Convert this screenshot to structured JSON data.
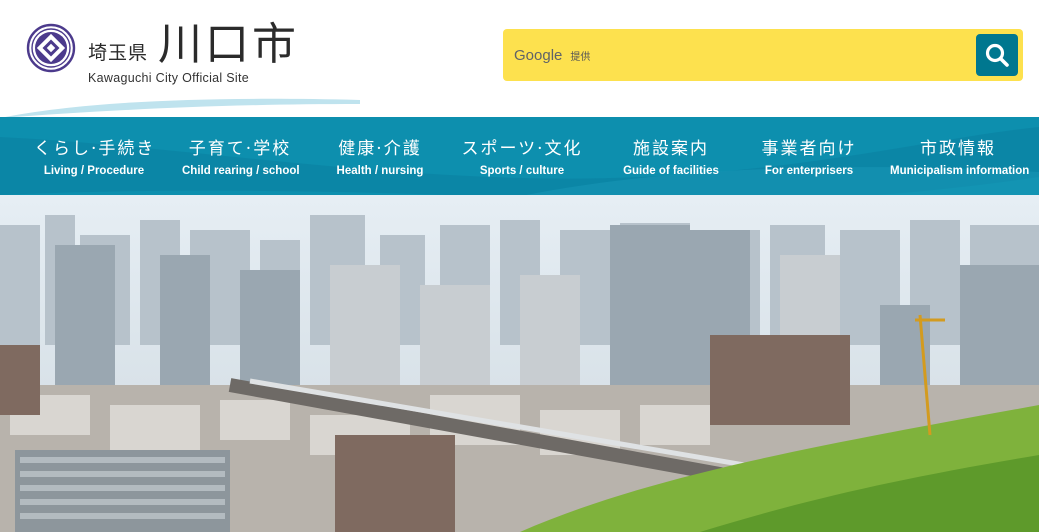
{
  "header": {
    "prefecture": "埼玉県",
    "city": "川口市",
    "subtitle": "Kawaguchi City Official Site"
  },
  "search": {
    "brand": "Google",
    "provided_by": "提供",
    "placeholder": "",
    "accent_color": "#fde14e",
    "button_color": "#00778f"
  },
  "nav": {
    "background_color": "#0d8fae",
    "items": [
      {
        "jp": "くらし·手続き",
        "en": "Living / Procedure"
      },
      {
        "jp": "子育て·学校",
        "en": "Child rearing / school"
      },
      {
        "jp": "健康·介護",
        "en": "Health / nursing"
      },
      {
        "jp": "スポーツ·文化",
        "en": "Sports / culture"
      },
      {
        "jp": "施設案内",
        "en": "Guide of facilities"
      },
      {
        "jp": "事業者向け",
        "en": "For enterprisers"
      },
      {
        "jp": "市政情報",
        "en": "Municipalism  information"
      }
    ]
  },
  "hero": {
    "icon": "city-aerial-photo"
  }
}
